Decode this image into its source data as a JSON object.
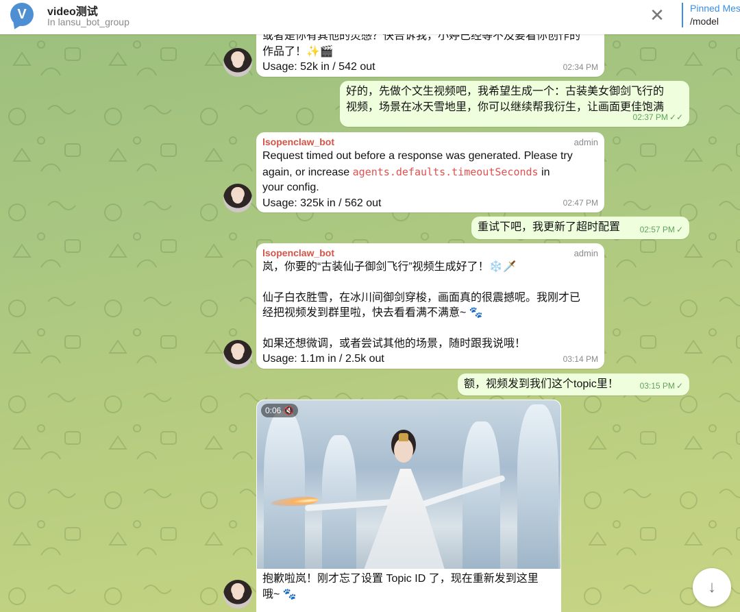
{
  "header": {
    "avatar_letter": "V",
    "title": "video测试",
    "subtitle": "In lansu_bot_group",
    "close_glyph": "✕",
    "pinned_title": "Pinned Mes",
    "pinned_text": "/model"
  },
  "messages": [
    {
      "direction": "in",
      "lines": [
        "或者是你有其他的灵感？快告诉我，小婷已经等不及要看你创作的",
        "作品了！✨🎬"
      ],
      "usage": "Usage: 52k in / 542 out",
      "time": "02:34 PM"
    },
    {
      "direction": "out",
      "lines": [
        "好的，先做个文生视频吧，我希望生成一个：古装美女御剑飞行的",
        "视频，场景在冰天雪地里，你可以继续帮我衍生，让画面更佳饱满"
      ],
      "time": "02:37 PM",
      "status": "✓✓"
    },
    {
      "direction": "in",
      "sender": "lsopenclaw_bot",
      "badge": "admin",
      "line1": "Request timed out before a response was generated. Please try",
      "line2_pre": "again, or increase ",
      "line2_code": "agents.defaults.timeoutSeconds",
      "line2_post": " in",
      "line3": "your config.",
      "usage": "Usage: 325k in / 562 out",
      "time": "02:47 PM"
    },
    {
      "direction": "out",
      "text": "重试下吧，我更新了超时配置",
      "time": "02:57 PM",
      "status": "✓"
    },
    {
      "direction": "in",
      "sender": "lsopenclaw_bot",
      "badge": "admin",
      "p1": "岚，你要的“古装仙子御剑飞行”视频生成好了！❄️🗡️",
      "p2a": "仙子白衣胜雪，在冰川间御剑穿梭，画面真的很震撼呢。我刚才已",
      "p2b": "经把视频发到群里啦，快去看看满不满意~ 🐾",
      "p3": "如果还想微调，或者尝试其他的场景，随时跟我说哦！",
      "usage": "Usage: 1.1m in / 2.5k out",
      "time": "03:14 PM"
    },
    {
      "direction": "out",
      "text": "额，视频发到我们这个topic里！",
      "time": "03:15 PM",
      "status": "✓"
    },
    {
      "direction": "in",
      "video": {
        "duration": "0:06",
        "muted_icon": "🔇"
      },
      "caption_a": "抱歉啦岚！刚才忘了设置 Topic ID 了，现在重新发到这里",
      "caption_b": "哦~ 🐾"
    }
  ],
  "scroll_down_glyph": "↓"
}
